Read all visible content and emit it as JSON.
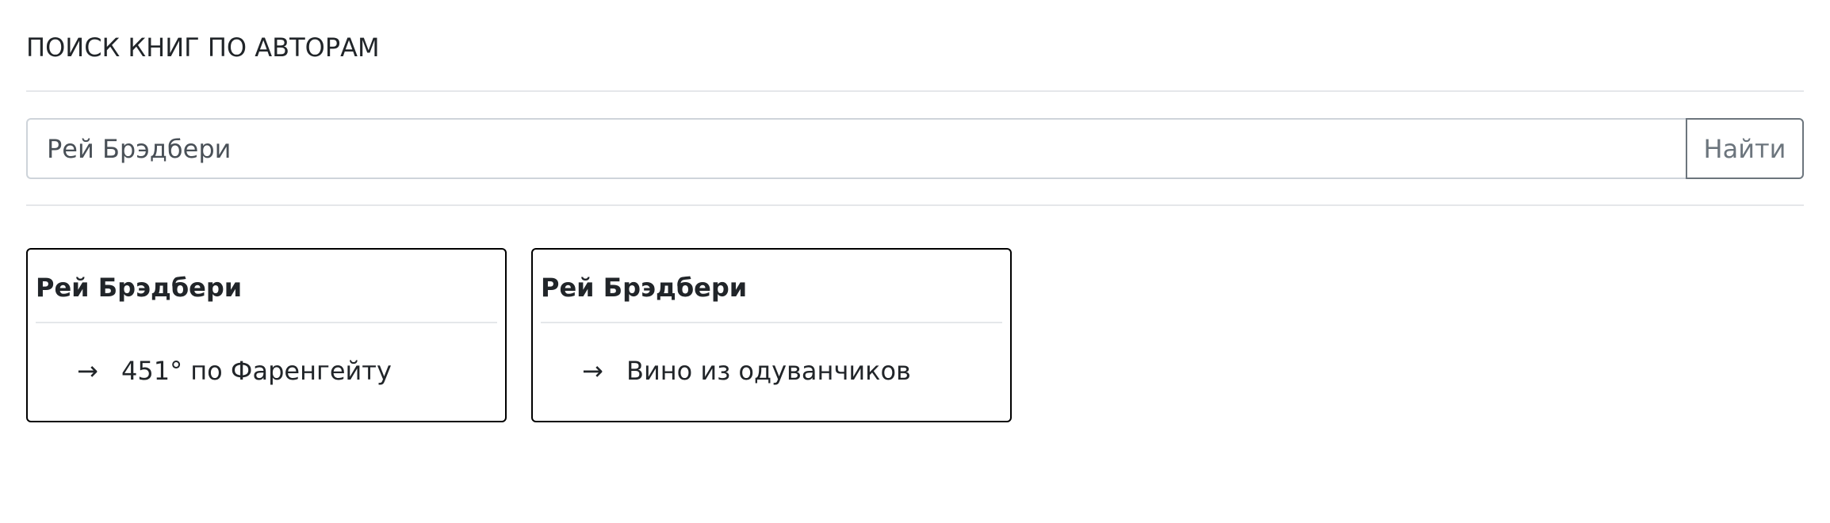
{
  "page": {
    "title": "ПОИСК КНИГ ПО АВТОРАМ"
  },
  "search": {
    "value": "Рей Брэдбери",
    "button_label": "Найти"
  },
  "results": [
    {
      "author": "Рей Брэдбери",
      "arrow": "→",
      "book": "451° по Фаренгейту"
    },
    {
      "author": "Рей Брэдбери",
      "arrow": "→",
      "book": "Вино из одуванчиков"
    }
  ]
}
